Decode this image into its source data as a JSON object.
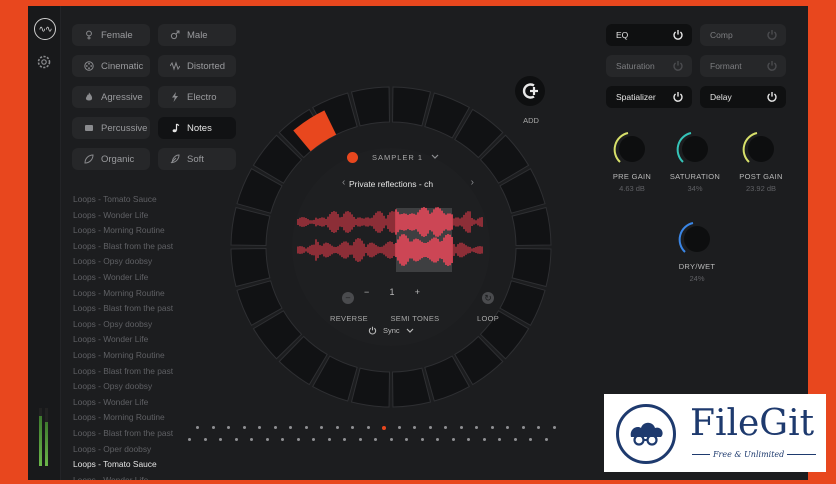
{
  "app": {
    "logo_text": "∿∿",
    "settings_icon": "gear-icon"
  },
  "tags": [
    {
      "label": "Female",
      "icon": "female-icon"
    },
    {
      "label": "Male",
      "icon": "male-icon"
    },
    {
      "label": "Cinematic",
      "icon": "film-reel-icon"
    },
    {
      "label": "Distorted",
      "icon": "distortion-icon"
    },
    {
      "label": "Agressive",
      "icon": "flame-icon"
    },
    {
      "label": "Electro",
      "icon": "lightning-icon"
    },
    {
      "label": "Percussive",
      "icon": "drum-icon"
    },
    {
      "label": "Notes",
      "icon": "music-note-icon",
      "active": true
    },
    {
      "label": "Organic",
      "icon": "organic-icon"
    },
    {
      "label": "Soft",
      "icon": "feather-icon"
    }
  ],
  "loops": [
    "Loops - Tomato Sauce",
    "Loops - Wonder Life",
    "Loops - Morning Routine",
    "Loops - Blast from the past",
    "Loops - Opsy doobsy",
    "Loops - Wonder Life",
    "Loops - Morning Routine",
    "Loops - Blast from the past",
    "Loops - Opsy doobsy",
    "Loops - Wonder Life",
    "Loops - Morning Routine",
    "Loops - Blast from the past",
    "Loops - Opsy doobsy",
    "Loops - Wonder Life",
    "Loops - Morning Routine",
    "Loops - Blast from the past",
    "Loops - Oper doobsy",
    "Loops - Tomato Sauce",
    "Loops - Wonder Life"
  ],
  "selected_loop_index": 17,
  "sampler": {
    "label": "SAMPLER 1",
    "preset_name": "Private reflections - ch",
    "reverse_label": "REVERSE",
    "semitones_label": "SEMI TONES",
    "semitones_value": "1",
    "minus": "−",
    "plus": "+",
    "loop_label": "LOOP",
    "sync_label": "Sync",
    "accent": "#e8471e"
  },
  "add": {
    "label": "ADD"
  },
  "fx": [
    {
      "label": "EQ",
      "on": true
    },
    {
      "label": "Comp",
      "on": false
    },
    {
      "label": "Saturation",
      "on": false
    },
    {
      "label": "Formant",
      "on": false
    },
    {
      "label": "Spatializer",
      "on": true
    },
    {
      "label": "Delay",
      "on": true
    }
  ],
  "knobs": [
    {
      "label": "PRE GAIN",
      "value": "4.63 dB",
      "color": "#d7e06a"
    },
    {
      "label": "SATURATION",
      "value": "34%",
      "color": "#35c4b8"
    },
    {
      "label": "POST GAIN",
      "value": "23.92 dB",
      "color": "#d7e06a"
    },
    {
      "label": "DRY/WET",
      "value": "24%",
      "color": "#3a86e6"
    }
  ],
  "step_sequencer": {
    "steps": 24,
    "active_step": 12
  },
  "watermark": {
    "title": "FileGit",
    "subtitle": "Free & Unlimited",
    "color": "#1e3a6e"
  }
}
